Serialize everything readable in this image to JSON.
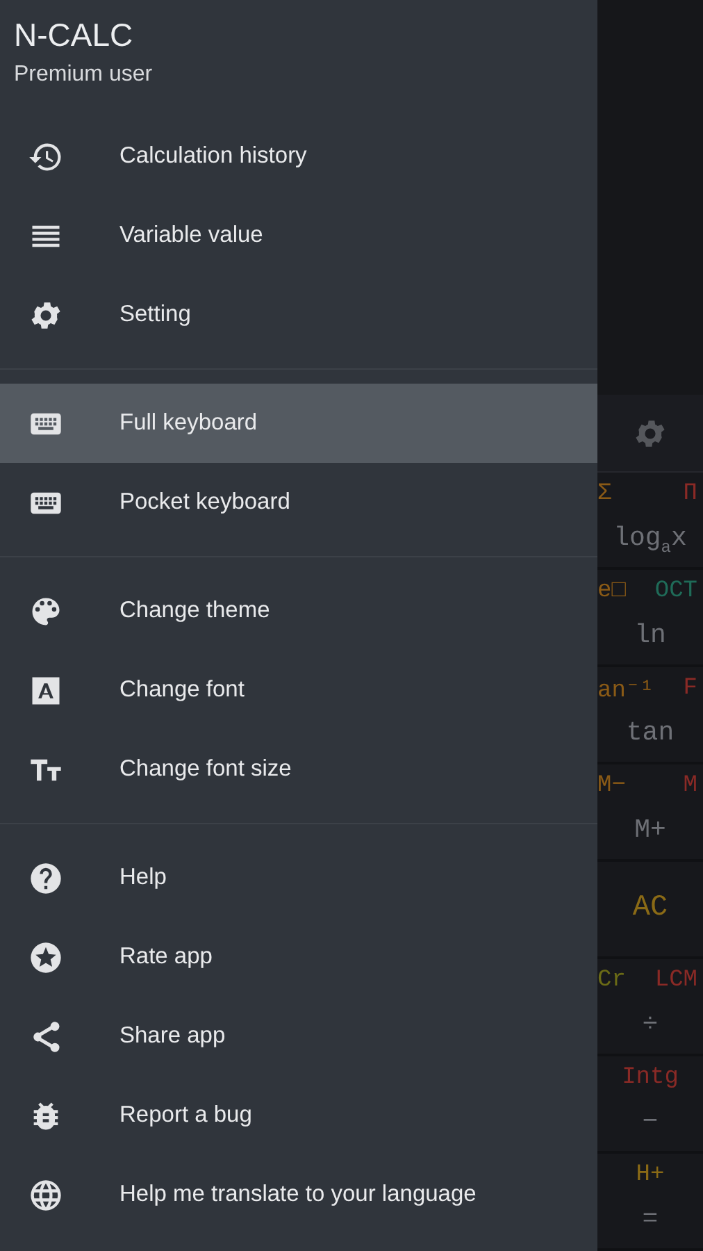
{
  "drawer": {
    "title": "N-CALC",
    "subtitle": "Premium user",
    "groups": [
      {
        "items": [
          {
            "label": "Calculation history",
            "selected": false
          },
          {
            "label": "Variable value",
            "selected": false
          },
          {
            "label": "Setting",
            "selected": false
          }
        ]
      },
      {
        "items": [
          {
            "label": "Full keyboard",
            "selected": true
          },
          {
            "label": "Pocket keyboard",
            "selected": false
          }
        ]
      },
      {
        "items": [
          {
            "label": "Change theme",
            "selected": false
          },
          {
            "label": "Change font",
            "selected": false
          },
          {
            "label": "Change font size",
            "selected": false
          }
        ]
      },
      {
        "items": [
          {
            "label": "Help",
            "selected": false
          },
          {
            "label": "Rate app",
            "selected": false
          },
          {
            "label": "Share app",
            "selected": false
          },
          {
            "label": "Report a bug",
            "selected": false
          },
          {
            "label": "Help me translate to your language",
            "selected": false
          }
        ]
      }
    ]
  },
  "keyboard": {
    "rows": [
      {
        "top": [
          {
            "text": "Σ",
            "color": "#8a5a16"
          },
          {
            "text": "Π",
            "color": "#8a2a26"
          }
        ],
        "main": "log$_{a}$x"
      },
      {
        "top": [
          {
            "text": "e□",
            "color": "#8a5a16"
          },
          {
            "text": "OCT",
            "color": "#1f6b58"
          }
        ],
        "main": "ln"
      },
      {
        "top": [
          {
            "text": "an⁻¹",
            "color": "#8a5a16"
          },
          {
            "text": "F",
            "color": "#8a2a26"
          }
        ],
        "main": "tan"
      },
      {
        "top": [
          {
            "text": "M−",
            "color": "#8a5a16"
          },
          {
            "text": "M",
            "color": "#8a2a26"
          }
        ],
        "main": "M+"
      },
      {
        "top": [],
        "big": {
          "text": "AC",
          "color": "#8a6a16"
        }
      },
      {
        "top": [
          {
            "text": "Cr",
            "color": "#6a6a16"
          },
          {
            "text": "LCM",
            "color": "#8a2a26"
          }
        ],
        "main": "÷"
      },
      {
        "top": [
          {
            "text": "Intg",
            "color": "#8a2a26"
          }
        ],
        "main": "−"
      },
      {
        "top": [
          {
            "text": "H+",
            "color": "#8a6a16"
          }
        ],
        "main": "="
      }
    ]
  }
}
